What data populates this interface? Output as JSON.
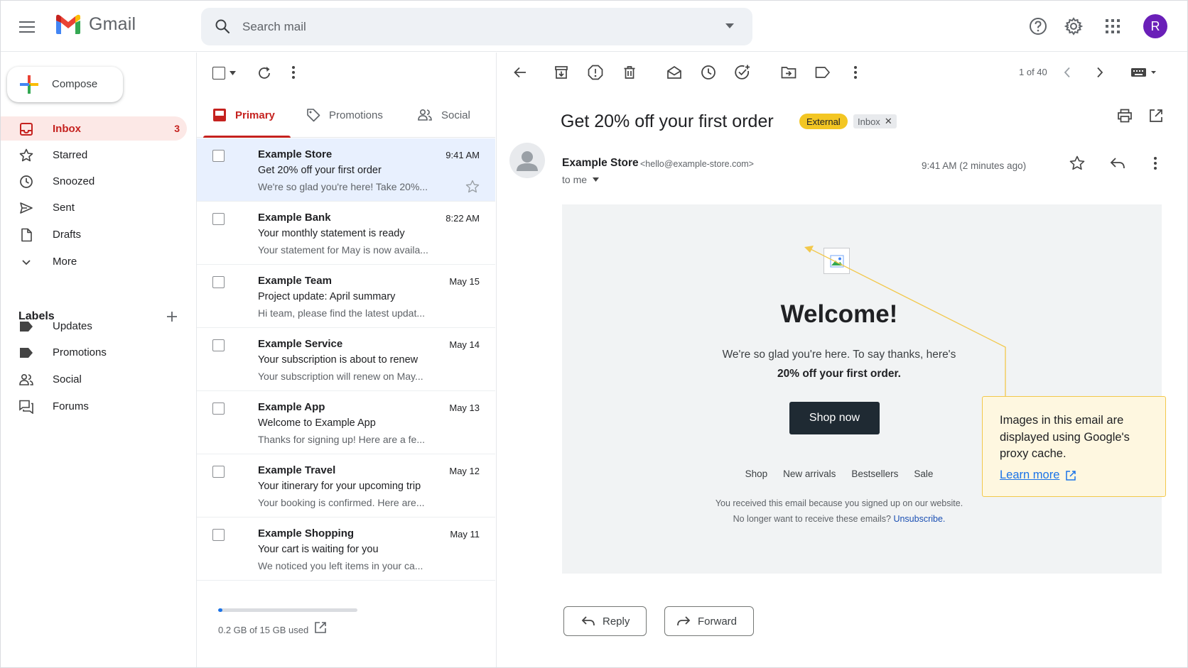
{
  "app": {
    "name": "Gmail"
  },
  "search": {
    "placeholder": "Search mail"
  },
  "account": {
    "initial": "R"
  },
  "colors": {
    "accent": "#c5221f",
    "avatar": "#6a1fb8",
    "external_chip": "#f3c623",
    "link": "#1a73e8"
  },
  "compose": {
    "label": "Compose"
  },
  "nav": [
    {
      "label": "Inbox",
      "count": "3",
      "icon": "inbox-icon"
    },
    {
      "label": "Starred",
      "icon": "star-icon"
    },
    {
      "label": "Snoozed",
      "icon": "clock-icon"
    },
    {
      "label": "Sent",
      "icon": "send-icon"
    },
    {
      "label": "Drafts",
      "icon": "draft-icon"
    },
    {
      "label": "More",
      "icon": "chevron-down-icon"
    }
  ],
  "labels": {
    "heading": "Labels",
    "items": [
      {
        "label": "Updates",
        "icon": "label-icon"
      },
      {
        "label": "Promotions",
        "icon": "label-icon"
      },
      {
        "label": "Social",
        "icon": "people-icon"
      },
      {
        "label": "Forums",
        "icon": "forum-icon"
      }
    ]
  },
  "tabs": [
    {
      "label": "Primary",
      "icon": "inbox-icon"
    },
    {
      "label": "Promotions",
      "icon": "tag-icon"
    },
    {
      "label": "Social",
      "icon": "people-icon"
    }
  ],
  "messages": [
    {
      "sender": "Example Store",
      "time": "9:41 AM",
      "subject": "Get 20% off your first order",
      "snippet": "We're so glad you're here! Take 20%..."
    },
    {
      "sender": "Example Bank",
      "time": "8:22 AM",
      "subject": "Your monthly statement is ready",
      "snippet": "Your statement for May is now availa..."
    },
    {
      "sender": "Example Team",
      "time": "May 15",
      "subject": "Project update: April summary",
      "snippet": "Hi team, please find the latest updat..."
    },
    {
      "sender": "Example Service",
      "time": "May 14",
      "subject": "Your subscription is about to renew",
      "snippet": "Your subscription will renew on May..."
    },
    {
      "sender": "Example App",
      "time": "May 13",
      "subject": "Welcome to Example App",
      "snippet": "Thanks for signing up! Here are a fe..."
    },
    {
      "sender": "Example Travel",
      "time": "May 12",
      "subject": "Your itinerary for your upcoming trip",
      "snippet": "Your booking is confirmed. Here are..."
    },
    {
      "sender": "Example Shopping",
      "time": "May 11",
      "subject": "Your cart is waiting for you",
      "snippet": "We noticed you left items in your ca..."
    }
  ],
  "storage": {
    "text": "0.2 GB of 15 GB used",
    "used_fraction": 0.013
  },
  "reader": {
    "pager": "1 of 40",
    "subject": "Get 20% off your first order",
    "chip_external": "External",
    "chip_inbox": "Inbox",
    "sender_name": "Example Store",
    "sender_email": "<hello@example-store.com>",
    "to": "to me",
    "time": "9:41 AM (2 minutes ago)"
  },
  "email": {
    "heading": "Welcome!",
    "line1": "We're so glad you're here. To say thanks, here's",
    "line2": "20% off your first order.",
    "cta": "Shop now",
    "footer_links": [
      "Shop",
      "New arrivals",
      "Bestsellers",
      "Sale"
    ],
    "note1": "You received this email because you signed up on our website.",
    "note2": "No longer want to receive these emails?",
    "unsubscribe": "Unsubscribe."
  },
  "callout": {
    "text": "Images in this email are displayed using Google's proxy cache.",
    "link": "Learn more"
  },
  "actions": {
    "reply": "Reply",
    "forward": "Forward"
  }
}
